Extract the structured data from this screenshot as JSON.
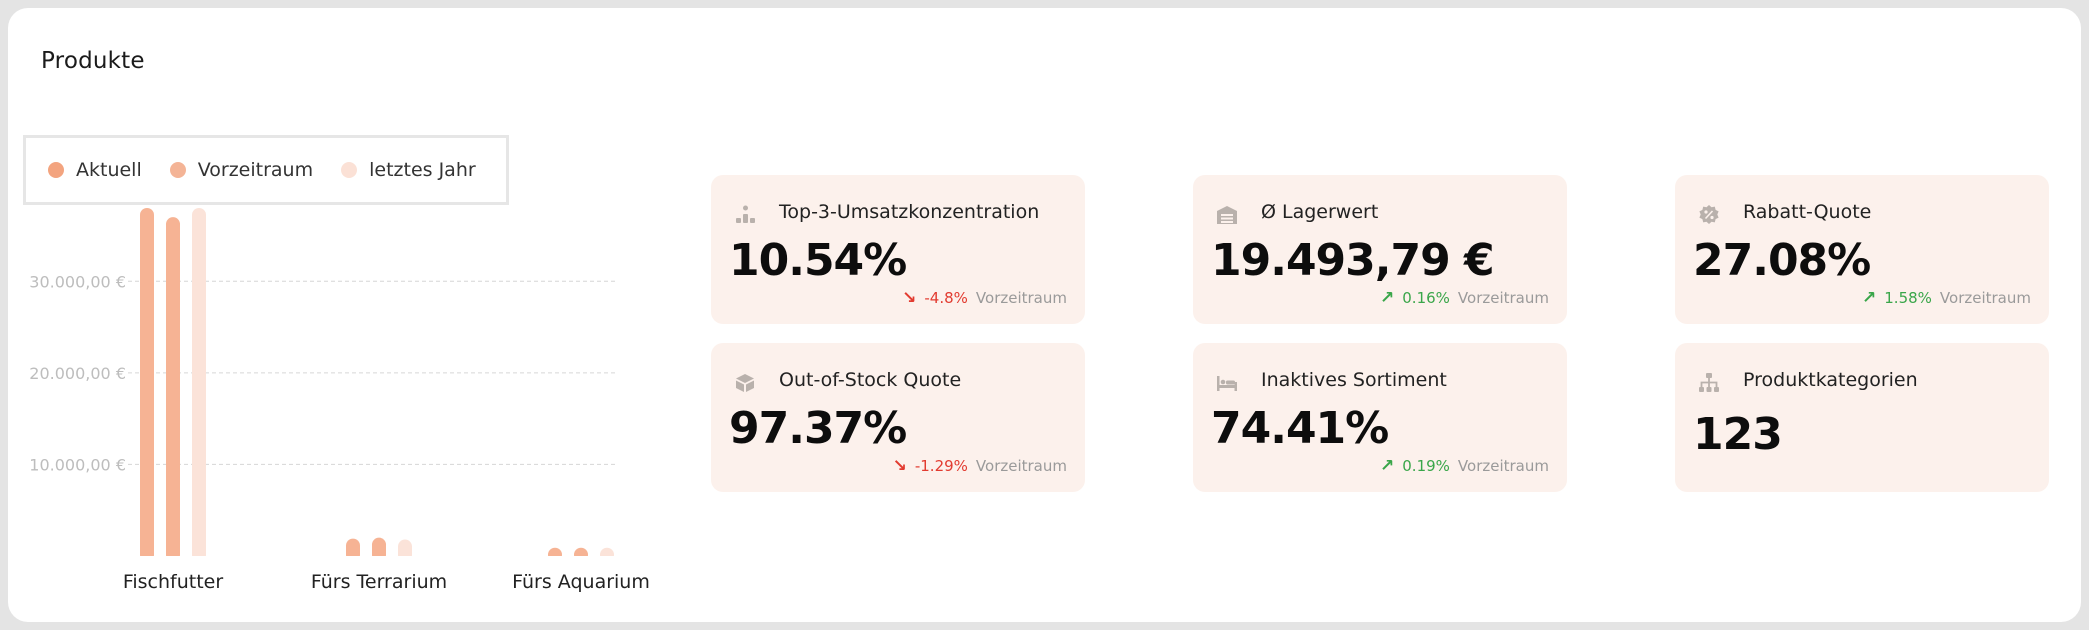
{
  "panel": {
    "title": "Produkte"
  },
  "legend": [
    {
      "label": "Aktuell",
      "color": "#f3a47f"
    },
    {
      "label": "Vorzeitraum",
      "color": "#f4b496"
    },
    {
      "label": "letztes Jahr",
      "color": "#fbe1d6"
    }
  ],
  "chart_data": {
    "type": "bar",
    "categories": [
      "Fischfutter",
      "Fürs Terrarium",
      "Fürs Aquarium"
    ],
    "series": [
      {
        "name": "Aktuell",
        "color": "#f6b394",
        "values": [
          38000,
          1900,
          900
        ]
      },
      {
        "name": "Vorzeitraum",
        "color": "#f6b394",
        "values": [
          37000,
          2000,
          900
        ]
      },
      {
        "name": "letztes Jahr",
        "color": "#fbe3d9",
        "values": [
          38000,
          1800,
          900
        ]
      }
    ],
    "yticks": [
      "10.000,00 €",
      "20.000,00 €",
      "30.000,00 €"
    ],
    "ytick_values": [
      10000,
      20000,
      30000
    ],
    "ylim": [
      0,
      40000
    ],
    "grid": true,
    "legend_position": "top-left"
  },
  "cards": [
    {
      "label": "Top-3-Umsatzkonzentration",
      "value": "10.54%",
      "icon": "ranking-icon",
      "delta": {
        "direction": "down",
        "arrow": "↘",
        "value": "-4.8%",
        "ref": "Vorzeitraum"
      }
    },
    {
      "label": "Ø Lagerwert",
      "value": "19.493,79 €",
      "icon": "warehouse-icon",
      "delta": {
        "direction": "up",
        "arrow": "↗",
        "value": "0.16%",
        "ref": "Vorzeitraum"
      }
    },
    {
      "label": "Rabatt-Quote",
      "value": "27.08%",
      "icon": "discount-badge-icon",
      "delta": {
        "direction": "up",
        "arrow": "↗",
        "value": "1.58%",
        "ref": "Vorzeitraum"
      }
    },
    {
      "label": "Out-of-Stock Quote",
      "value": "97.37%",
      "icon": "box-icon",
      "delta": {
        "direction": "down",
        "arrow": "↘",
        "value": "-1.29%",
        "ref": "Vorzeitraum"
      }
    },
    {
      "label": "Inaktives Sortiment",
      "value": "74.41%",
      "icon": "bed-icon",
      "delta": {
        "direction": "up",
        "arrow": "↗",
        "value": "0.19%",
        "ref": "Vorzeitraum"
      }
    },
    {
      "label": "Produktkategorien",
      "value": "123",
      "icon": "sitemap-icon"
    }
  ]
}
